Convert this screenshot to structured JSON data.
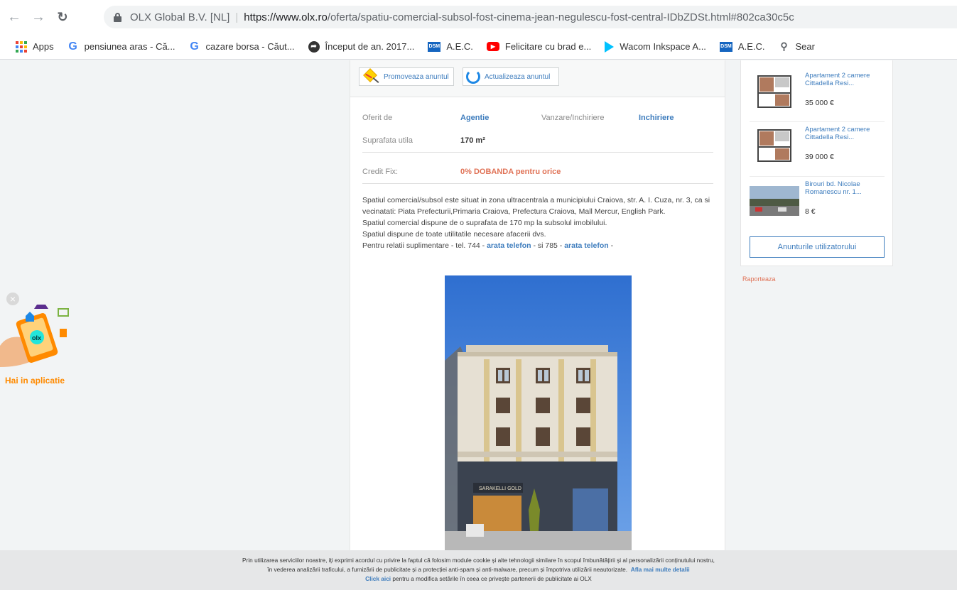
{
  "browser": {
    "organization": "OLX Global B.V. [NL]",
    "url_base": "https://www.olx.ro",
    "url_path": "/oferta/spatiu-comercial-subsol-fost-cinema-jean-negulescu-fost-central-IDbZDSt.html#802ca30c5c"
  },
  "bookmarks": [
    {
      "label": "Apps",
      "icon": "apps-grid-icon"
    },
    {
      "label": "pensiunea aras - Că...",
      "icon": "google-icon"
    },
    {
      "label": "cazare borsa - Căut...",
      "icon": "google-icon"
    },
    {
      "label": "Început de an. 2017...",
      "icon": "globe-icon"
    },
    {
      "label": "A.E.C.",
      "icon": "dsm-icon"
    },
    {
      "label": "Felicitare cu brad e...",
      "icon": "youtube-icon"
    },
    {
      "label": "Wacom Inkspace A...",
      "icon": "play-store-icon"
    },
    {
      "label": "A.E.C.",
      "icon": "dsm-icon"
    },
    {
      "label": "Sear",
      "icon": "search-icon"
    }
  ],
  "actions": {
    "promote": "Promoveaza anuntul",
    "refresh": "Actualizeaza anuntul"
  },
  "details": {
    "offered_by_label": "Oferit de",
    "offered_by_value": "Agentie",
    "sale_rent_label": "Vanzare/Inchiriere",
    "sale_rent_value": "Inchiriere",
    "area_label": "Suprafata utila",
    "area_value": "170 m²",
    "credit_label": "Credit Fix:",
    "credit_value": "0% DOBANDA pentru orice"
  },
  "description": {
    "p1": "Spatiul comercial/subsol este situat in zona ultracentrala a municipiului Craiova, str. A. I. Cuza, nr. 3, ca si vecinatati: Piata Prefecturii,Primaria Craiova, Prefectura Craiova, Mall Mercur, English Park.",
    "p2": "Spatiul comercial dispune de o suprafata de 170 mp la subsolul imobilului.",
    "p3": "Spatiul dispune de toate utilitatile necesare afacerii dvs.",
    "p4_a": "Pentru relatii suplimentare - tel. 744 - ",
    "p4_link1": "arata telefon",
    "p4_b": " - si 785 - ",
    "p4_link2": "arata telefon",
    "p4_c": " -"
  },
  "photo": {
    "sign": "SARAKELLI GOLD"
  },
  "sidebar": {
    "items": [
      {
        "title": "Apartament 2 camere Cittadella Resi...",
        "price": "35 000 €"
      },
      {
        "title": "Apartament 2 camere Cittadella Resi...",
        "price": "39 000 €"
      },
      {
        "title": "Birouri bd. Nicolae Romanescu nr. 1...",
        "price": "8 €"
      }
    ],
    "user_ads_button": "Anunturile utilizatorului",
    "report": "Raporteaza"
  },
  "promo": {
    "label": "Hai in aplicatie",
    "logo": "olx"
  },
  "cookie": {
    "line1": "Prin utilizarea serviciilor noastre, iți exprimi acordul cu privire la faptul că folosim module cookie și alte tehnologii similare în scopul îmbunătățirii și al personalizării conținutului nostru,",
    "line2": "în vederea analizării traficului, a furnizării de publicitate și a protecției anti-spam și anti-malware, precum și împotriva utilizării neautorizate.",
    "line2_link": "Afla mai multe detalii",
    "line3_link": "Click aici",
    "line3": " pentru a modifica setările în ceea ce privește partenerii de publicitate ai OLX"
  }
}
